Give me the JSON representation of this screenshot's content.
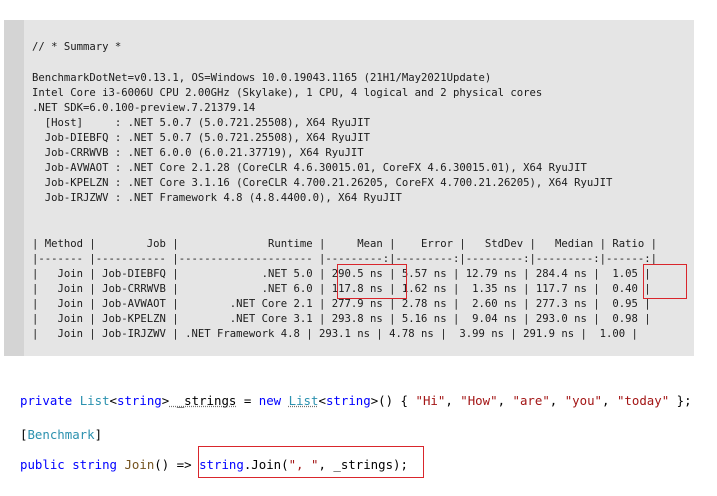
{
  "summary": {
    "lines": [
      "// * Summary *",
      "",
      "BenchmarkDotNet=v0.13.1, OS=Windows 10.0.19043.1165 (21H1/May2021Update)",
      "Intel Core i3-6006U CPU 2.00GHz (Skylake), 1 CPU, 4 logical and 2 physical cores",
      ".NET SDK=6.0.100-preview.7.21379.14",
      "  [Host]     : .NET 5.0.7 (5.0.721.25508), X64 RyuJIT",
      "  Job-DIEBFQ : .NET 5.0.7 (5.0.721.25508), X64 RyuJIT",
      "  Job-CRRWVB : .NET 6.0.0 (6.0.21.37719), X64 RyuJIT",
      "  Job-AVWAOT : .NET Core 2.1.28 (CoreCLR 4.6.30015.01, CoreFX 4.6.30015.01), X64 RyuJIT",
      "  Job-KPELZN : .NET Core 3.1.16 (CoreCLR 4.700.21.26205, CoreFX 4.700.21.26205), X64 RyuJIT",
      "  Job-IRJZWV : .NET Framework 4.8 (4.8.4400.0), X64 RyuJIT",
      "",
      "",
      "| Method |        Job |              Runtime |     Mean |    Error |   StdDev |   Median | Ratio |",
      "|------- |----------- |--------------------- |---------:|---------:|---------:|---------:|------:|",
      "|   Join | Job-DIEBFQ |             .NET 5.0 | 290.5 ns | 5.57 ns | 12.79 ns | 284.4 ns |  1.05 |",
      "|   Join | Job-CRRWVB |             .NET 6.0 | 117.8 ns | 1.62 ns |  1.35 ns | 117.7 ns |  0.40 |",
      "|   Join | Job-AVWAOT |        .NET Core 2.1 | 277.9 ns | 2.78 ns |  2.60 ns | 277.3 ns |  0.95 |",
      "|   Join | Job-KPELZN |        .NET Core 3.1 | 293.8 ns | 5.16 ns |  9.04 ns | 293.0 ns |  0.98 |",
      "|   Join | Job-IRJZWV | .NET Framework 4.8 | 293.1 ns | 4.78 ns |  3.99 ns | 291.9 ns |  1.00 |"
    ]
  },
  "code": {
    "line1": {
      "kw_private": "private",
      "type_list": "List",
      "lt1": "<",
      "type_string1": "string",
      "gt1": ">",
      "field": " _strings",
      "eq": " = ",
      "kw_new": "new",
      "sp": " ",
      "type_list2": "List",
      "lt2": "<",
      "type_string2": "string",
      "gt2": ">",
      "init_open": "() { ",
      "s1": "\"Hi\"",
      "c1": ", ",
      "s2": "\"How\"",
      "c2": ", ",
      "s3": "\"are\"",
      "c3": ", ",
      "s4": "\"you\"",
      "c4": ", ",
      "s5": "\"today\"",
      "init_close": " };"
    },
    "line2": {
      "open": "[",
      "attr": "Benchmark",
      "close": "]"
    },
    "line3": {
      "kw_public": "public",
      "kw_string": " string",
      "method": " Join",
      "sig": "() => ",
      "body_type": "string",
      "body_call": ".Join(",
      "sep": "\", \"",
      "args": ", _strings);"
    }
  },
  "colors": {
    "keyword": "#0000ff",
    "type": "#2b91af",
    "string": "#a31515",
    "highlight": "#d9262c",
    "panel": "#e5e5e5"
  }
}
